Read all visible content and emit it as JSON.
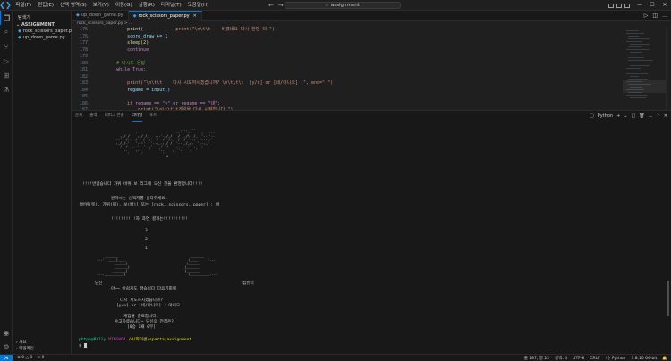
{
  "window": {
    "title": "assignment",
    "menu": [
      "파일(F)",
      "편집(E)",
      "선택 영역(S)",
      "보기(V)",
      "이동(G)",
      "실행(R)",
      "터미널(T)",
      "도움말(H)"
    ]
  },
  "sidebar": {
    "title": "탐색기",
    "section": "ASSIGNMENT",
    "files": [
      "rock_scissors_paper.py",
      "up_down_game.py"
    ],
    "bottom": [
      "개요",
      "타임라인"
    ]
  },
  "tabs": [
    {
      "label": "up_down_game.py",
      "active": false
    },
    {
      "label": "rock_scissors_paper.py",
      "active": true
    }
  ],
  "breadcrumb": "rock_scissors_paper.py > ...",
  "editor": {
    "lines": [
      {
        "n": "175",
        "t": "            print(\"\\n\\t\\t    비겼네요 다시 한번 더!\")"
      },
      {
        "n": "176",
        "t": "            score_draw += 1"
      },
      {
        "n": "177",
        "t": "            sleep(2)"
      },
      {
        "n": "178",
        "t": "            continue"
      },
      {
        "n": "179",
        "t": ""
      },
      {
        "n": "180",
        "t": "        # 다시도 용답"
      },
      {
        "n": "181",
        "t": "        while True:"
      },
      {
        "n": "182",
        "t": ""
      },
      {
        "n": "183",
        "t": "            print(\"\\n\\t\\t    다시 시도하시겠습니까? \\n\\t\\t\\t  [y/n] or [네/아니오] :\", end=\" \")"
      },
      {
        "n": "184",
        "t": "            regame = input()"
      },
      {
        "n": "185",
        "t": ""
      },
      {
        "n": "186",
        "t": "            if regame == \"y\" or regame == \"네\":"
      },
      {
        "n": "187",
        "t": "                print(\"\\n\\t\\t\\t게임을 다시 시작합니다.\")"
      },
      {
        "n": "188",
        "t": "                break"
      }
    ]
  },
  "panel": {
    "tabs": [
      "문제",
      "출력",
      "디버그 콘솔",
      "터미널",
      "포트"
    ],
    "active_tab": "터미널",
    "terminal_label": "Python"
  },
  "terminal": {
    "welcome": "!!!!반갑습니다 가위 바위 보 리그에 오신 것을 환영합니다!!!!",
    "choose": "원하시는 선택지를 골라주세요.",
    "options": "[바위(묵), 가위(찌), 보(빠)] 또는 [rock, scissors, paper] : 빠",
    "result_header": "!!!!!!!!!!자 과연 결과는!!!!!!!!!!",
    "count": [
      "3",
      "2",
      "1"
    ],
    "you": "당신",
    "computer": "컴퓨터",
    "draw": "아~~ 아쉽게도 졌습니다 다음기회에",
    "retry": "다시 시도하시겠습니까?",
    "retry_opts": "[y/n] or [네/아니오] : 아니오",
    "end": "게임을 종료합니다.",
    "thanks": "수고하셨습니다~ 당신의 전적은?",
    "record": "[0승 1패 0무]",
    "prompt_user": "phtpe@Billy",
    "prompt_host": "MINGW64",
    "prompt_path": "/d/파이썬/sparta/assignment",
    "prompt_symbol": "$"
  },
  "status": {
    "left": [
      "⊗ 0 △ 0",
      "⊙ 0"
    ],
    "right": [
      "줄 187, 열 22",
      "공백: 4",
      "UTF-8",
      "CRLF",
      "{} Python",
      "3.8.10 64-bit"
    ]
  }
}
